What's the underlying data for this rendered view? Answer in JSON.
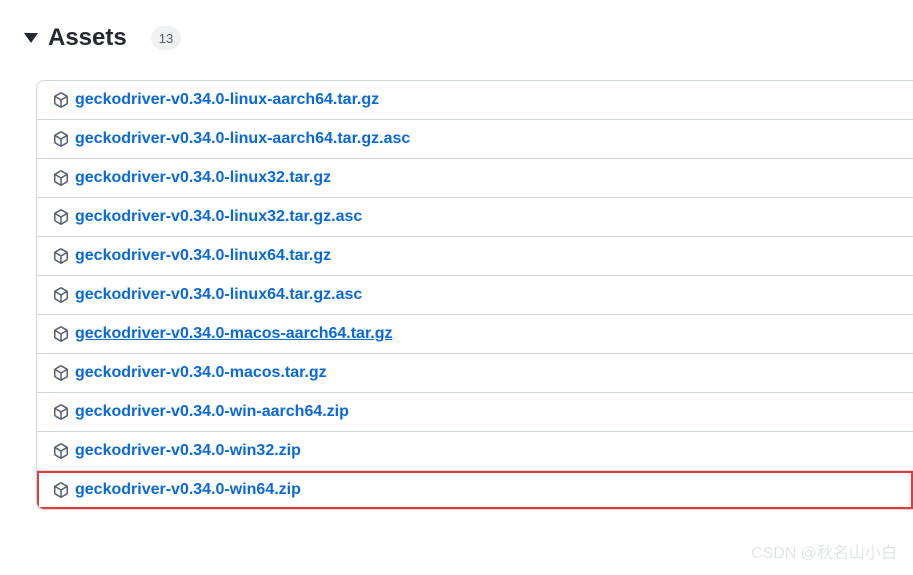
{
  "header": {
    "title": "Assets",
    "count": "13"
  },
  "assets": [
    {
      "name": "geckodriver-v0.34.0-linux-aarch64.tar.gz",
      "highlighted": false,
      "underlined": false
    },
    {
      "name": "geckodriver-v0.34.0-linux-aarch64.tar.gz.asc",
      "highlighted": false,
      "underlined": false
    },
    {
      "name": "geckodriver-v0.34.0-linux32.tar.gz",
      "highlighted": false,
      "underlined": false
    },
    {
      "name": "geckodriver-v0.34.0-linux32.tar.gz.asc",
      "highlighted": false,
      "underlined": false
    },
    {
      "name": "geckodriver-v0.34.0-linux64.tar.gz",
      "highlighted": false,
      "underlined": false
    },
    {
      "name": "geckodriver-v0.34.0-linux64.tar.gz.asc",
      "highlighted": false,
      "underlined": false
    },
    {
      "name": "geckodriver-v0.34.0-macos-aarch64.tar.gz",
      "highlighted": false,
      "underlined": true
    },
    {
      "name": "geckodriver-v0.34.0-macos.tar.gz",
      "highlighted": false,
      "underlined": false
    },
    {
      "name": "geckodriver-v0.34.0-win-aarch64.zip",
      "highlighted": false,
      "underlined": false
    },
    {
      "name": "geckodriver-v0.34.0-win32.zip",
      "highlighted": false,
      "underlined": false
    },
    {
      "name": "geckodriver-v0.34.0-win64.zip",
      "highlighted": true,
      "underlined": false
    }
  ],
  "watermark": "CSDN @秋名山小白"
}
